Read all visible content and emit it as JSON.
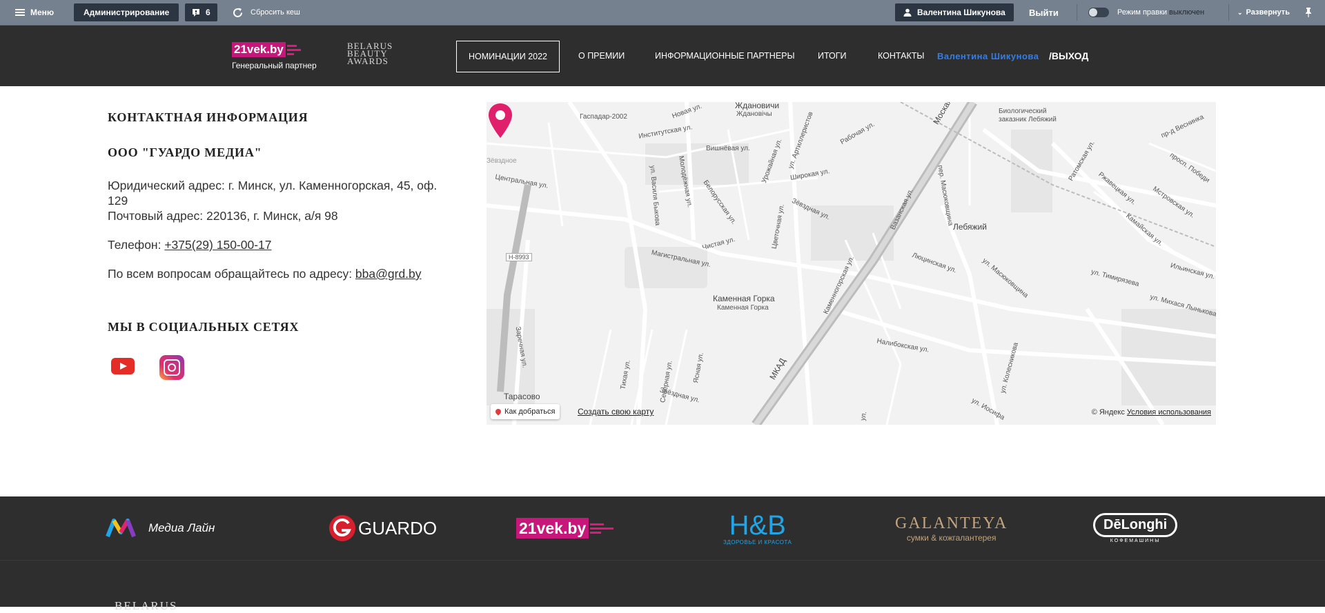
{
  "adminbar": {
    "menu_label": "Меню",
    "admin_label": "Администрирование",
    "notifications_count": "6",
    "cache_label": "Сбросить кеш",
    "user_name": "Валентина Шикунова",
    "logout_label": "Выйти",
    "edit_mode_label": "Режим правки",
    "edit_mode_state": "выключен",
    "expand_label": "Развернуть"
  },
  "header": {
    "logo_21vek": "21vek.by",
    "partner_caption": "Генеральный партнер",
    "bba_logo": [
      "BELARUS",
      "BEAUTY",
      "AWARDS"
    ],
    "nav": [
      "НОМИНАЦИИ 2022",
      "О ПРЕМИИ",
      "ИНФОРМАЦИОННЫЕ ПАРТНЕРЫ",
      "ИТОГИ",
      "КОНТАКТЫ"
    ],
    "user_name": "Валентина Шикунова",
    "exit_label": "/ВЫХОД"
  },
  "contact": {
    "title": "КОНТАКТНАЯ ИНФОРМАЦИЯ",
    "company": "ООО \"ГУАРДО МЕДИА\"",
    "legal_address": "Юридический адрес: г. Минск, ул. Каменногорская, 45, оф. 129",
    "postal_address": "Почтовый адрес: 220136, г. Минск, а/я 98",
    "phone_label": "Телефон: ",
    "phone": "+375(29) 150-00-17",
    "email_label": "По всем вопросам обращайтесь по адресу: ",
    "email": "bba@grd.by",
    "social_title": "МЫ В СОЦИАЛЬНЫХ СЕТЯХ",
    "social_icons": [
      "youtube-icon",
      "instagram-icon"
    ]
  },
  "map": {
    "labels": [
      "Ждановичи",
      "Ждановічы",
      "Гаспадар-2002",
      "Новая ул.",
      "Институтская ул.",
      "Вишнёвая ул.",
      "Урожайная ул.",
      "ул. Артиллеристов",
      "Рабочая ул.",
      "Широкая ул.",
      "Зёвздная ул.",
      "Белорусская ул.",
      "Молодёжная ул.",
      "ул. Василя Быкова",
      "Чистая ул.",
      "Цветочная ул.",
      "Магистральная ул.",
      "Каменная Горка",
      "Каменная Горка",
      "Центральная ул.",
      "Зёвздное",
      "Заречная ул.",
      "H-8993",
      "Тарасово",
      "МКАД",
      "Каменногорская ул.",
      "Налибокская ул.",
      "Люцинская ул.",
      "Вазанская ул.",
      "пер. Масюковщина",
      "ул. Масюковщина",
      "Лебяжий",
      "Биологический заказник Лебяжий",
      "ул. Тимирязева",
      "Ратомская ул.",
      "Ржавецкая ул.",
      "Камайская ул.",
      "Мстровская ул.",
      "просп. Победи",
      "пр-д Веснинка",
      "Ильинская ул.",
      "ул. Михася Лынькова",
      "ул. Колесникова",
      "ул. Иосифа",
      "Тихая ул.",
      "Северная ул.",
      "Ясная ул.",
      "Звёздная ул.",
      "Моская ул.",
      "ул."
    ],
    "route_label": "Как добраться",
    "create_label": "Создать свою карту",
    "copyright": "© Яндекс",
    "terms_label": "Условия использования",
    "accent_color": "#e0206b"
  },
  "partners": {
    "media_line": "Медиа Лайн",
    "guardo": "GUARDO",
    "vek21": "21vek.by",
    "hb": "H&B",
    "hb_sub": "ЗДОРОВЬЕ И КРАСОТА",
    "galanteya": "GALANTEYA",
    "galanteya_sub": "сумки & кожгалантерея",
    "delonghi": "DēLonghi",
    "delonghi_sub": "КОФЕМАШИНЫ"
  },
  "footer": {
    "logo_text": "BELARUS"
  }
}
